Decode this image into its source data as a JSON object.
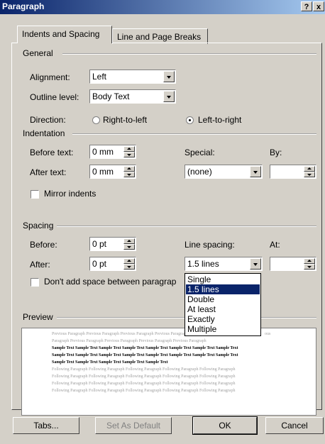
{
  "window": {
    "title": "Paragraph",
    "help_label": "?",
    "close_label": "x"
  },
  "tabs": [
    {
      "label": "Indents and Spacing",
      "active": true
    },
    {
      "label": "Line and Page Breaks",
      "active": false
    }
  ],
  "general": {
    "group_label": "General",
    "alignment_label": "Alignment:",
    "alignment_value": "Left",
    "outline_label": "Outline level:",
    "outline_value": "Body Text",
    "direction_label": "Direction:",
    "rtl_label": "Right-to-left",
    "ltr_label": "Left-to-right",
    "direction_selected": "Left-to-right"
  },
  "indentation": {
    "group_label": "Indentation",
    "before_label": "Before text:",
    "before_value": "0 mm",
    "after_label": "After text:",
    "after_value": "0 mm",
    "special_label": "Special:",
    "special_value": "(none)",
    "by_label": "By:",
    "by_value": "",
    "mirror_label": "Mirror indents",
    "mirror_checked": false
  },
  "spacing": {
    "group_label": "Spacing",
    "before_label": "Before:",
    "before_value": "0 pt",
    "after_label": "After:",
    "after_value": "0 pt",
    "line_spacing_label": "Line spacing:",
    "line_spacing_value": "1.5 lines",
    "at_label": "At:",
    "at_value": "",
    "dont_add_label": "Don't add space between paragrap",
    "dont_add_checked": false,
    "line_spacing_options": [
      "Single",
      "1.5 lines",
      "Double",
      "At least",
      "Exactly",
      "Multiple"
    ],
    "line_spacing_selected": "1.5 lines"
  },
  "preview": {
    "group_label": "Preview",
    "previous_lines": [
      "Previous Paragraph Previous Paragraph Previous Paragraph Previous Paragraph",
      "Paragraph Previous Paragraph Previous Paragraph Previous Paragraph Previous Paragraph"
    ],
    "previous_tail": "ous",
    "sample_lines": [
      "Sample Text Sample Text Sample Text Sample Text Sample Text Sample Text Sample Text Sample Text",
      "Sample Text Sample Text Sample Text Sample Text Sample Text Sample Text Sample Text Sample Text",
      "Sample Text Sample Text Sample Text Sample Text Sample Text"
    ],
    "following_lines": [
      "Following Paragraph Following Paragraph Following Paragraph Following Paragraph Following Paragraph",
      "Following Paragraph Following Paragraph Following Paragraph Following Paragraph Following Paragraph",
      "Following Paragraph Following Paragraph Following Paragraph Following Paragraph Following Paragraph",
      "Following Paragraph Following Paragraph Following Paragraph Following Paragraph Following Paragraph"
    ]
  },
  "buttons": {
    "tabs": "Tabs...",
    "set_default": "Set As Default",
    "ok": "OK",
    "cancel": "Cancel"
  },
  "colors": {
    "titlebar_start": "#0a246a",
    "titlebar_end": "#a6caf0",
    "dialog_bg": "#d4d0c8",
    "selection": "#0a246a"
  }
}
